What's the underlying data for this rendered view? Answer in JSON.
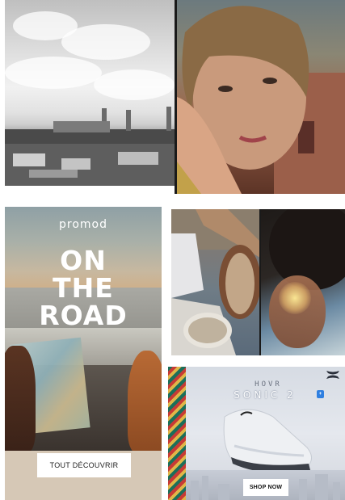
{
  "ads": {
    "promod": {
      "logo": "promod",
      "headline": [
        "ON",
        "THE",
        "ROAD"
      ],
      "cta": "TOUT DÉCOUVRIR"
    },
    "under_armour": {
      "brand": "HOVR",
      "product": "SONIC 2",
      "badge": "+",
      "cta": "SHOP NOW",
      "logo_icon": "under-armour-logo-icon"
    }
  }
}
